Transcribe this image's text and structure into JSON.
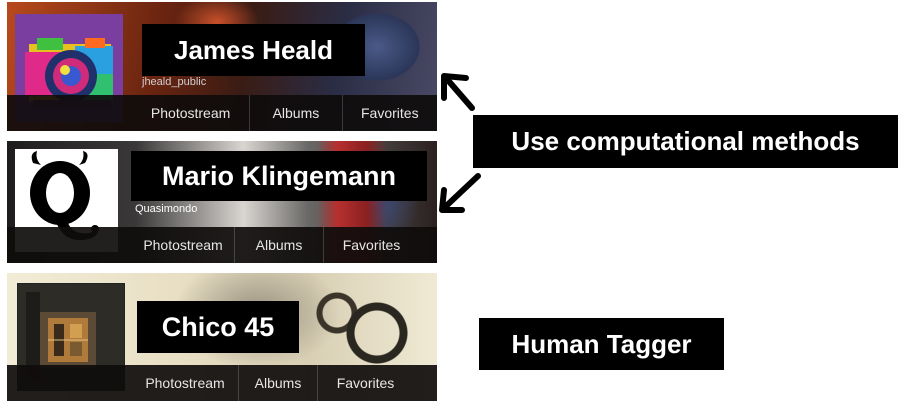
{
  "cards": [
    {
      "name": "James Heald",
      "username": "jheald_public",
      "nav": [
        "Photostream",
        "Albums",
        "Favorites"
      ]
    },
    {
      "name": "Mario Klingemann",
      "username": "Quasimondo",
      "nav": [
        "Photostream",
        "Albums",
        "Favorites"
      ]
    },
    {
      "name": "Chico 45",
      "nav": [
        "Photostream",
        "Albums",
        "Favorites"
      ]
    }
  ],
  "labels": {
    "computational": "Use computational methods",
    "human": "Human Tagger"
  },
  "avatar_glyph": "Q",
  "colors": {
    "label_bg": "#000000",
    "label_text": "#ffffff",
    "avatar1_bg": "#7a3ea0"
  }
}
